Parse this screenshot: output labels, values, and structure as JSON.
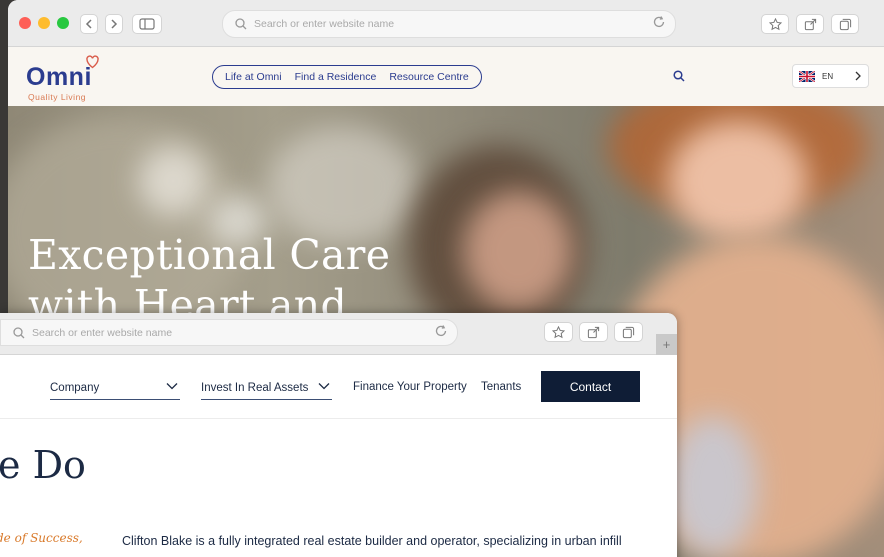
{
  "back_browser": {
    "address_placeholder": "Search or enter website name",
    "new_tab_label": "+"
  },
  "omni": {
    "logo_word": "Omni",
    "logo_tagline": "Quality Living",
    "nav": [
      "Life at Omni",
      "Find a Residence",
      "Resource Centre"
    ],
    "language": "EN",
    "hero_title_line1": "Exceptional Care",
    "hero_title_line2": "with Heart and"
  },
  "front_browser": {
    "address_placeholder": "Search or enter website name",
    "new_tab_label": "+"
  },
  "clifton": {
    "nav": {
      "company": "Company",
      "invest": "Invest In Real Assets",
      "finance": "Finance Your Property",
      "tenants": "Tenants",
      "contact": "Contact"
    },
    "heading_fragment": "e Do",
    "tagline_fragment": "de of Success,",
    "paragraph": "Clifton Blake is a fully integrated real estate builder and operator, specializing in urban infill"
  },
  "colors": {
    "omni_blue": "#2b3c8f",
    "omni_orange": "#d97a53",
    "clifton_navy": "#0f1d36",
    "accent_orange": "#d97a2b"
  }
}
